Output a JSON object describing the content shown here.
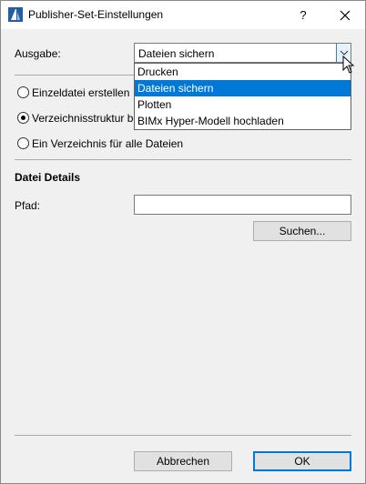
{
  "window": {
    "title": "Publisher-Set-Einstellungen",
    "help_label": "?"
  },
  "output": {
    "label": "Ausgabe:",
    "selected": "Dateien sichern",
    "options": [
      "Drucken",
      "Dateien sichern",
      "Plotten",
      "BIMx Hyper-Modell hochladen"
    ]
  },
  "radios": [
    {
      "label": "Einzeldatei erstellen",
      "selected": false
    },
    {
      "label": "Verzeichnisstruktur be",
      "selected": true
    },
    {
      "label": "Ein Verzeichnis für alle Dateien",
      "selected": false
    }
  ],
  "details": {
    "heading": "Datei Details",
    "path_label": "Pfad:",
    "path_value": "",
    "browse_label": "Suchen..."
  },
  "footer": {
    "cancel_label": "Abbrechen",
    "ok_label": "OK"
  },
  "colors": {
    "accent": "#0078d7",
    "dialog_bg": "#f0f0f0"
  }
}
